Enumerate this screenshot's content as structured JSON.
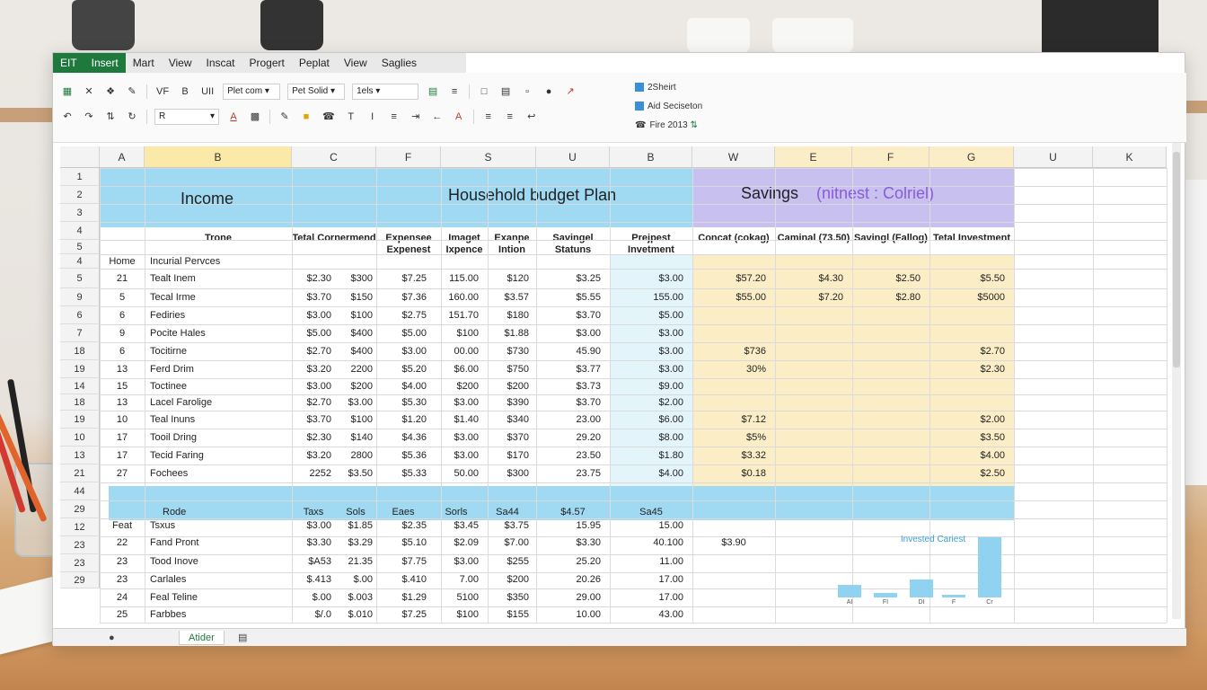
{
  "menu": [
    "EIT",
    "Insert",
    "Mart",
    "View",
    "Inscat",
    "Progert",
    "Peplat",
    "View",
    "Saglies"
  ],
  "ribbon": {
    "row1": [
      "VF",
      "B",
      "UII"
    ],
    "font_select": "Plet com",
    "size_select": "Pet Solid",
    "style_select": "1els",
    "row2_font": "R",
    "side": [
      "2Sheirt",
      "Aid Seciseton",
      "Fire 2013"
    ]
  },
  "columns": [
    "A",
    "B",
    "C",
    "F",
    "S",
    "U",
    "B",
    "W",
    "E",
    "F",
    "G",
    "U",
    "K"
  ],
  "row_numbers": [
    "1",
    "2",
    "3",
    "4",
    "5",
    "4",
    "5",
    "9",
    "6",
    "7",
    "18",
    "19",
    "14",
    "18",
    "19",
    "10",
    "13",
    "21",
    "44",
    "29",
    "12",
    "23",
    "23",
    "29"
  ],
  "titles": {
    "income": "Income",
    "plan": "Household budget Plan",
    "savings": "Savings",
    "savings_note": "(nitnest : Colriel)"
  },
  "col_headers": [
    "Trone",
    "Tetal Cornermend",
    "Expensee Expenest",
    "Imaget Ixpence",
    "Exanpe Intion",
    "Savingel Statuns",
    "Prejpest Invetment",
    "Concat (cokag)",
    "Caminal (73.50)",
    "Savingl (Fallog)",
    "Tetal Investment"
  ],
  "income_rows": [
    {
      "a": "Home",
      "b": "Incurial Pervces",
      "c": "",
      "d": "",
      "e": "",
      "f": "",
      "g": "",
      "h": "",
      "i": "",
      "j": "",
      "k": "",
      "l": "",
      "m": "",
      "n": ""
    },
    {
      "a": "21",
      "b": "Tealt Inem",
      "c": "$2.30",
      "d": "$300",
      "e": "$7.25",
      "f": "115.00",
      "g": "$120",
      "h": "$3.25",
      "i": "$3.00",
      "j": "$57.20",
      "k": "$4.30",
      "l": "$2.50",
      "m": "$5.50"
    },
    {
      "a": "5",
      "b": "Tecal Irme",
      "c": "$3.70",
      "d": "$150",
      "e": "$7.36",
      "f": "160.00",
      "g": "$3.57",
      "h": "$5.55",
      "i": "155.00",
      "j": "$55.00",
      "k": "$7.20",
      "l": "$2.80",
      "m": "$5000"
    },
    {
      "a": "6",
      "b": "Fediries",
      "c": "$3.00",
      "d": "$100",
      "e": "$2.75",
      "f": "151.70",
      "g": "$180",
      "h": "$3.70",
      "i": "$5.00",
      "j": "",
      "k": "",
      "l": "",
      "m": ""
    },
    {
      "a": "9",
      "b": "Pocite Hales",
      "c": "$5.00",
      "d": "$400",
      "e": "$5.00",
      "f": "$100",
      "g": "$1.88",
      "h": "$3.00",
      "i": "$3.00",
      "j": "",
      "k": "",
      "l": "",
      "m": ""
    },
    {
      "a": "6",
      "b": "Tocitirne",
      "c": "$2.70",
      "d": "$400",
      "e": "$3.00",
      "f": "00.00",
      "g": "$730",
      "h": "45.90",
      "i": "$3.00",
      "j": "$736",
      "k": "",
      "l": "",
      "m": "$2.70"
    },
    {
      "a": "13",
      "b": "Ferd Drim",
      "c": "$3.20",
      "d": "2200",
      "e": "$5.20",
      "f": "$6.00",
      "g": "$750",
      "h": "$3.77",
      "i": "$3.00",
      "j": "30%",
      "k": "",
      "l": "",
      "m": "$2.30"
    },
    {
      "a": "15",
      "b": "Toctinee",
      "c": "$3.00",
      "d": "$200",
      "e": "$4.00",
      "f": "$200",
      "g": "$200",
      "h": "$3.73",
      "i": "$9.00",
      "j": "",
      "k": "",
      "l": "",
      "m": ""
    },
    {
      "a": "13",
      "b": "Lacel Farolige",
      "c": "$2.70",
      "d": "$3.00",
      "e": "$5.30",
      "f": "$3.00",
      "g": "$390",
      "h": "$3.70",
      "i": "$2.00",
      "j": "",
      "k": "",
      "l": "",
      "m": ""
    },
    {
      "a": "10",
      "b": "Teal Inuns",
      "c": "$3.70",
      "d": "$100",
      "e": "$1.20",
      "f": "$1.40",
      "g": "$340",
      "h": "23.00",
      "i": "$6.00",
      "j": "$7.12",
      "k": "",
      "l": "",
      "m": "$2.00"
    },
    {
      "a": "17",
      "b": "Tooil Dring",
      "c": "$2.30",
      "d": "$140",
      "e": "$4.36",
      "f": "$3.00",
      "g": "$370",
      "h": "29.20",
      "i": "$8.00",
      "j": "$5%",
      "k": "",
      "l": "",
      "m": "$3.50"
    },
    {
      "a": "17",
      "b": "Tecid Faring",
      "c": "$3.20",
      "d": "2800",
      "e": "$5.36",
      "f": "$3.00",
      "g": "$170",
      "h": "23.50",
      "i": "$1.80",
      "j": "$3.32",
      "k": "",
      "l": "",
      "m": "$4.00"
    },
    {
      "a": "27",
      "b": "Fochees",
      "c": "2252",
      "d": "$3.50",
      "e": "$5.33",
      "f": "50.00",
      "g": "$300",
      "h": "23.75",
      "i": "$4.00",
      "j": "$0.18",
      "k": "",
      "l": "",
      "m": "$2.50"
    }
  ],
  "band2": {
    "a": "",
    "b": "Rode",
    "c": "Taxs",
    "d": "Sols",
    "e": "Eaes",
    "f": "Sorls",
    "g": "Sa44",
    "h": "$4.57",
    "i": "Sa45"
  },
  "lower_rows": [
    {
      "a": "Feat",
      "b": "Tsxus",
      "c": "$3.00",
      "d": "$1.85",
      "e": "$2.35",
      "f": "$3.45",
      "g": "$3.75",
      "h": "15.95",
      "i": "15.00",
      "j": ""
    },
    {
      "a": "22",
      "b": "Fand Pront",
      "c": "$3.30",
      "d": "$3.29",
      "e": "$5.10",
      "f": "$2.09",
      "g": "$7.00",
      "h": "$3.30",
      "i": "40.100",
      "j": "$3.90"
    },
    {
      "a": "23",
      "b": "Tood Inove",
      "c": "$A53",
      "d": "21.35",
      "e": "$7.75",
      "f": "$3.00",
      "g": "$255",
      "h": "25.20",
      "i": "11.00",
      "j": ""
    },
    {
      "a": "23",
      "b": "Carlales",
      "c": "$.413",
      "d": "$.00",
      "e": "$.410",
      "f": "7.00",
      "g": "$200",
      "h": "20.26",
      "i": "17.00",
      "j": ""
    },
    {
      "a": "24",
      "b": "Feal Teline",
      "c": "$.00",
      "d": "$.003",
      "e": "$1.29",
      "f": "5100",
      "g": "$350",
      "h": "29.00",
      "i": "17.00",
      "j": ""
    },
    {
      "a": "25",
      "b": "Farbbes",
      "c": "$/.0",
      "d": "$.010",
      "e": "$7.25",
      "f": "$100",
      "g": "$155",
      "h": "10.00",
      "i": "43.00",
      "j": ""
    }
  ],
  "mini_chart": {
    "title": "Invested Cariest",
    "labels": [
      "AI",
      "FI",
      "DI",
      "F",
      "Cr"
    ]
  },
  "chart_data": {
    "type": "bar",
    "title": "Invested Cariest",
    "categories": [
      "AI",
      "FI",
      "DI",
      "F",
      "Cr"
    ],
    "values": [
      16,
      6,
      22,
      3,
      74
    ],
    "ylim": [
      0,
      80
    ]
  },
  "sheet_tabs": [
    "Atider"
  ],
  "colors": {
    "blue_band": "#9fd9f2",
    "purple_band": "#c8c0ee",
    "yellow": "#fbeec6",
    "light_blue": "#e4f4fb",
    "green": "#1e7a3c"
  }
}
